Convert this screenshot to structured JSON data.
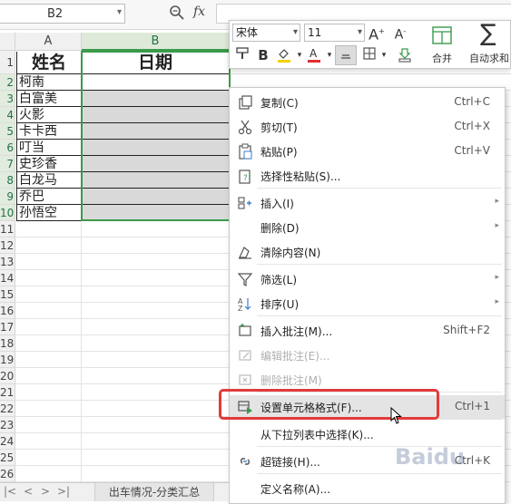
{
  "formula_bar": {
    "cell_ref": "B2",
    "fx_label": "fx",
    "formula": ""
  },
  "columns": [
    {
      "label": "A"
    },
    {
      "label": "B"
    }
  ],
  "row_numbers": [
    "1",
    "2",
    "3",
    "4",
    "5",
    "6",
    "7",
    "8",
    "9",
    "10",
    "11",
    "12",
    "13",
    "14",
    "15",
    "16",
    "17",
    "18",
    "19",
    "20",
    "21",
    "22",
    "23",
    "24",
    "25",
    "26"
  ],
  "table": {
    "header_name": "姓名",
    "header_date": "日期",
    "names": [
      "柯南",
      "白富美",
      "火影",
      "卡卡西",
      "叮当",
      "史珍香",
      "白龙马",
      "乔巴",
      "孙悟空"
    ]
  },
  "mini_toolbar": {
    "font": "宋体",
    "size": "11",
    "bold": "B",
    "merge_label": "合并",
    "autosum_label": "自动求和"
  },
  "context_menu": {
    "items": [
      {
        "label": "复制(C)",
        "shortcut": "Ctrl+C"
      },
      {
        "label": "剪切(T)",
        "shortcut": "Ctrl+X"
      },
      {
        "label": "粘贴(P)",
        "shortcut": "Ctrl+V"
      },
      {
        "label": "选择性粘贴(S)...",
        "shortcut": ""
      },
      {
        "label": "插入(I)",
        "shortcut": ""
      },
      {
        "label": "删除(D)",
        "shortcut": ""
      },
      {
        "label": "清除内容(N)",
        "shortcut": ""
      },
      {
        "label": "筛选(L)",
        "shortcut": ""
      },
      {
        "label": "排序(U)",
        "shortcut": ""
      },
      {
        "label": "插入批注(M)...",
        "shortcut": "Shift+F2"
      },
      {
        "label": "编辑批注(E)...",
        "shortcut": ""
      },
      {
        "label": "删除批注(M)",
        "shortcut": ""
      },
      {
        "label": "设置单元格格式(F)...",
        "shortcut": "Ctrl+1"
      },
      {
        "label": "从下拉列表中选择(K)...",
        "shortcut": ""
      },
      {
        "label": "超链接(H)...",
        "shortcut": "Ctrl+K"
      },
      {
        "label": "定义名称(A)...",
        "shortcut": ""
      }
    ]
  },
  "sheet_tabs": {
    "active": "出车情况-分类汇总"
  },
  "watermark": "Baidu"
}
